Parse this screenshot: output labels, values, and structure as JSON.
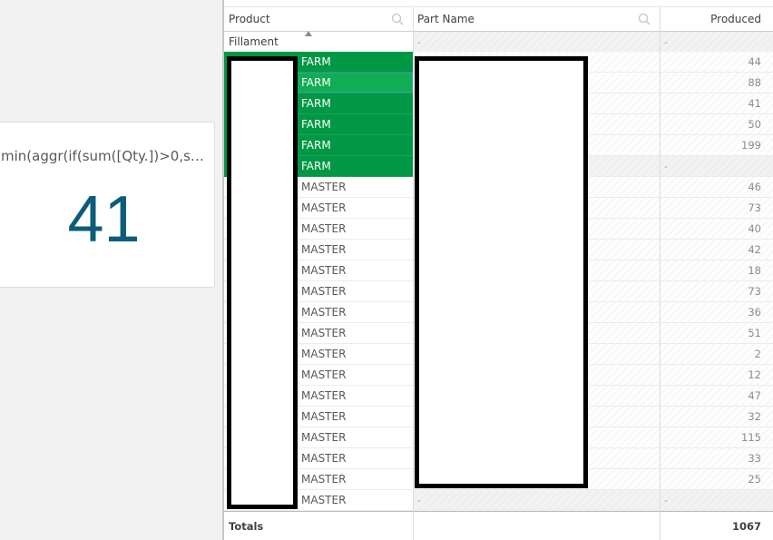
{
  "kpi": {
    "title": "min(aggr(if(sum([Qty.])>0,s…",
    "value": "41"
  },
  "table": {
    "columns": [
      {
        "label": "Product",
        "search_icon": "search-icon",
        "sort": "ascending"
      },
      {
        "label": "Part Name",
        "search_icon": "search-icon"
      },
      {
        "label": "Produced"
      }
    ],
    "first_row": {
      "product": "Fillament",
      "part_name": "-",
      "produced": "-"
    },
    "rows": [
      {
        "type": "FARM",
        "produced": "44",
        "state": "selected"
      },
      {
        "type": "FARM",
        "produced": "88",
        "state": "selected-hover"
      },
      {
        "type": "FARM",
        "produced": "41",
        "state": "selected"
      },
      {
        "type": "FARM",
        "produced": "50",
        "state": "selected"
      },
      {
        "type": "FARM",
        "produced": "199",
        "state": "selected"
      },
      {
        "type": "FARM",
        "produced": "-",
        "state": "selected"
      },
      {
        "type": "MASTER",
        "produced": "46"
      },
      {
        "type": "MASTER",
        "produced": "73"
      },
      {
        "type": "MASTER",
        "produced": "40"
      },
      {
        "type": "MASTER",
        "produced": "42"
      },
      {
        "type": "MASTER",
        "produced": "18"
      },
      {
        "type": "MASTER",
        "produced": "73"
      },
      {
        "type": "MASTER",
        "produced": "36"
      },
      {
        "type": "MASTER",
        "produced": "51"
      },
      {
        "type": "MASTER",
        "produced": "2"
      },
      {
        "type": "MASTER",
        "produced": "12"
      },
      {
        "type": "MASTER",
        "produced": "47"
      },
      {
        "type": "MASTER",
        "produced": "32"
      },
      {
        "type": "MASTER",
        "produced": "115"
      },
      {
        "type": "MASTER",
        "produced": "33"
      },
      {
        "type": "MASTER",
        "produced": "25"
      },
      {
        "type": "MASTER",
        "produced": "-",
        "part_name": "-"
      }
    ],
    "totals": {
      "label": "Totals",
      "produced": "1067"
    }
  },
  "colors": {
    "selected_green": "#009845",
    "kpi_value": "#0d5c7a"
  }
}
